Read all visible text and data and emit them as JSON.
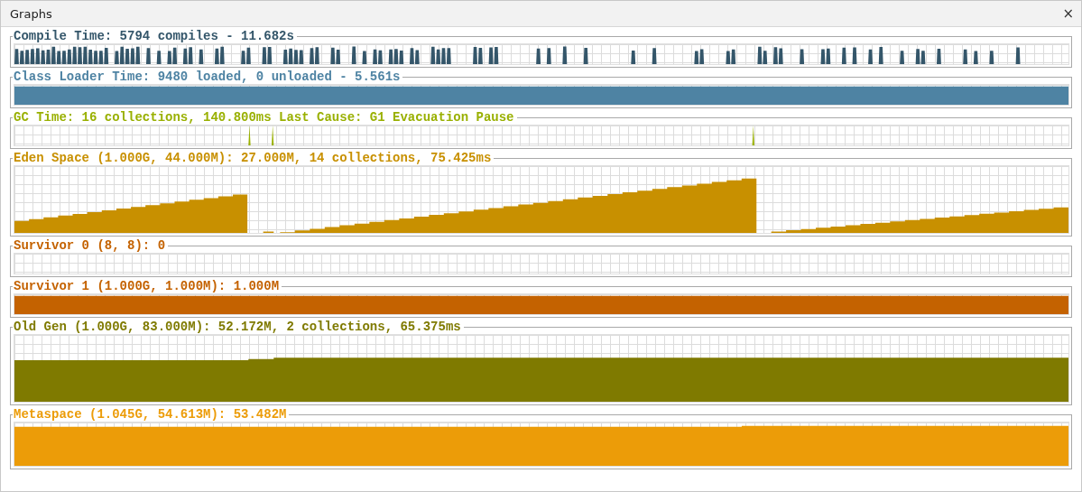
{
  "window": {
    "title": "Graphs",
    "close": "×"
  },
  "panels": [
    {
      "label": "Compile Time: 5794 compiles - 11.682s",
      "color": "#34566a",
      "kind": "spikes"
    },
    {
      "label": "Class Loader Time: 9480 loaded, 0 unloaded - 5.561s",
      "color": "#4e83a3",
      "kind": "fill"
    },
    {
      "label": "GC Time: 16 collections, 140.800ms Last Cause: G1 Evacuation Pause",
      "color": "#99b000",
      "kind": "blips"
    },
    {
      "label": "Eden Space (1.000G, 44.000M): 27.000M, 14 collections, 75.425ms",
      "color": "#c89000",
      "kind": "sawtooth"
    },
    {
      "label": "Survivor 0 (8, 8): 0",
      "color": "#c46200",
      "kind": "empty"
    },
    {
      "label": "Survivor 1 (1.000G, 1.000M): 1.000M",
      "color": "#c46200",
      "kind": "fill"
    },
    {
      "label": "Old Gen (1.000G, 83.000M): 52.172M, 2 collections, 65.375ms",
      "color": "#7f7a00",
      "kind": "steps"
    },
    {
      "label": "Metaspace (1.045G, 54.613M): 53.482M",
      "color": "#ec9c08",
      "kind": "plateau"
    }
  ]
}
